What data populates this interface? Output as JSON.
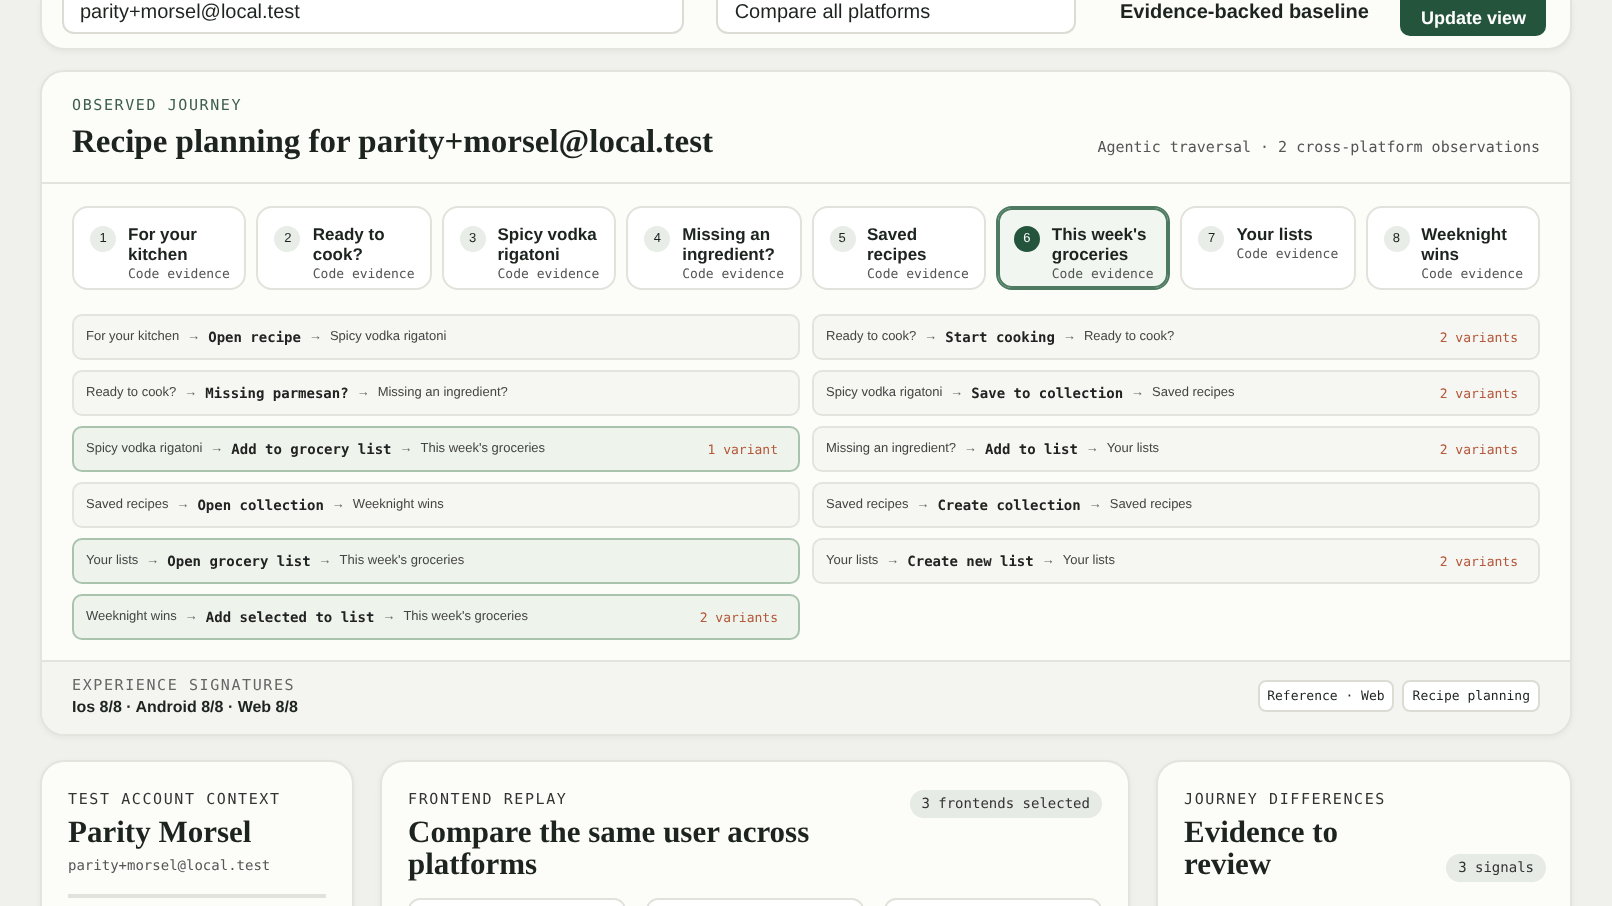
{
  "toolbar": {
    "account_field": {
      "value": "parity+morsel@local.test"
    },
    "platform_select": {
      "value": "Compare all platforms"
    },
    "baseline_label": "Evidence-backed baseline",
    "update_button": "Update view"
  },
  "journey": {
    "eyebrow": "OBSERVED JOURNEY",
    "title": "Recipe planning for parity+morsel@local.test",
    "meta": "Agentic traversal · 2 cross-platform observations",
    "steps": [
      {
        "number": "1",
        "title": "For your kitchen",
        "subtitle": "Code evidence",
        "selected": false
      },
      {
        "number": "2",
        "title": "Ready to cook?",
        "subtitle": "Code evidence",
        "selected": false
      },
      {
        "number": "3",
        "title": "Spicy vodka rigatoni",
        "subtitle": "Code evidence",
        "selected": false
      },
      {
        "number": "4",
        "title": "Missing an ingredient?",
        "subtitle": "Code evidence",
        "selected": false
      },
      {
        "number": "5",
        "title": "Saved recipes",
        "subtitle": "Code evidence",
        "selected": false
      },
      {
        "number": "6",
        "title": "This week's groceries",
        "subtitle": "Code evidence",
        "selected": true
      },
      {
        "number": "7",
        "title": "Your lists",
        "subtitle": "Code evidence",
        "selected": false
      },
      {
        "number": "8",
        "title": "Weeknight wins",
        "subtitle": "Code evidence",
        "selected": false
      }
    ],
    "arrow": "→",
    "transitions_left": [
      {
        "from": "For your kitchen",
        "action": "Open recipe",
        "to": "Spicy vodka rigatoni",
        "highlighted": false
      },
      {
        "from": "Ready to cook?",
        "action": "Missing parmesan?",
        "to": "Missing an ingredient?",
        "highlighted": false
      },
      {
        "from": "Spicy vodka rigatoni",
        "action": "Add to grocery list",
        "to": "This week's groceries",
        "variants": "1 variant",
        "highlighted": true
      },
      {
        "from": "Saved recipes",
        "action": "Open collection",
        "to": "Weeknight wins",
        "highlighted": false
      },
      {
        "from": "Your lists",
        "action": "Open grocery list",
        "to": "This week's groceries",
        "highlighted": true
      },
      {
        "from": "Weeknight wins",
        "action": "Add selected to list",
        "to": "This week's groceries",
        "variants": "2 variants",
        "highlighted": true
      }
    ],
    "transitions_right": [
      {
        "from": "Ready to cook?",
        "action": "Start cooking",
        "to": "Ready to cook?",
        "variants": "2 variants",
        "highlighted": false
      },
      {
        "from": "Spicy vodka rigatoni",
        "action": "Save to collection",
        "to": "Saved recipes",
        "variants": "2 variants",
        "highlighted": false
      },
      {
        "from": "Missing an ingredient?",
        "action": "Add to list",
        "to": "Your lists",
        "variants": "2 variants",
        "highlighted": false
      },
      {
        "from": "Saved recipes",
        "action": "Create collection",
        "to": "Saved recipes",
        "highlighted": false
      },
      {
        "from": "Your lists",
        "action": "Create new list",
        "to": "Your lists",
        "variants": "2 variants",
        "highlighted": false
      }
    ],
    "signatures": {
      "label": "EXPERIENCE SIGNATURES",
      "value": "Ios 8/8 · Android 8/8 · Web 8/8",
      "chips": [
        "Reference · Web",
        "Recipe planning"
      ]
    }
  },
  "account": {
    "eyebrow": "TEST ACCOUNT CONTEXT",
    "name": "Parity Morsel",
    "email": "parity+morsel@local.test"
  },
  "replay": {
    "eyebrow": "FRONTEND REPLAY",
    "title": "Compare the same user across platforms",
    "badge": "3 frontends selected"
  },
  "differences": {
    "eyebrow": "JOURNEY DIFFERENCES",
    "title": "Evidence to review",
    "badge": "3 signals"
  }
}
